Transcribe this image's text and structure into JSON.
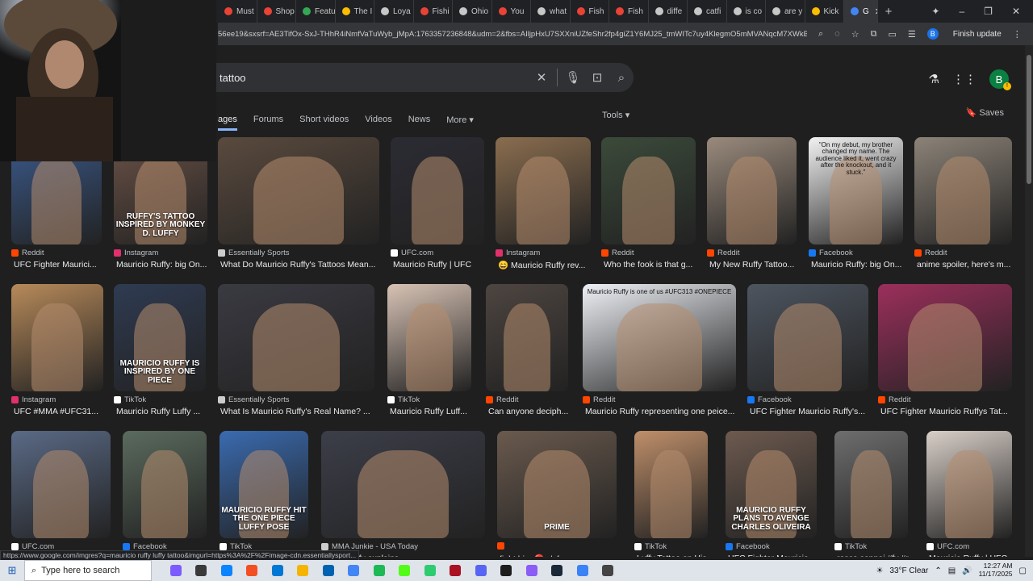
{
  "browser": {
    "tabs": [
      {
        "label": "Must",
        "color": "#ea4335"
      },
      {
        "label": "Shop",
        "color": "#ea4335"
      },
      {
        "label": "Featu",
        "color": "#34a853"
      },
      {
        "label": "The I",
        "color": "#fbbc04"
      },
      {
        "label": "Loya",
        "color": "#c7c7c7"
      },
      {
        "label": "Fishi",
        "color": "#ea4335"
      },
      {
        "label": "Ohio",
        "color": "#c7c7c7"
      },
      {
        "label": "You",
        "color": "#ea4335"
      },
      {
        "label": "what",
        "color": "#c7c7c7"
      },
      {
        "label": "Fish",
        "color": "#ea4335"
      },
      {
        "label": "Fish",
        "color": "#ea4335"
      },
      {
        "label": "diffe",
        "color": "#c7c7c7"
      },
      {
        "label": "catfi",
        "color": "#c7c7c7"
      },
      {
        "label": "is co",
        "color": "#c7c7c7"
      },
      {
        "label": "are y",
        "color": "#c7c7c7"
      },
      {
        "label": "Kick",
        "color": "#fbbc04"
      }
    ],
    "active_tab_label": "G",
    "new_tab": "+",
    "url": "56ee19&sxsrf=AE3TifOx-SxJ-THhR4iNmfVaTuWyb_jMpA:1763357236848&udm=2&fbs=AIljpHxU7SXXniUZfeShr2fp4giZ1Y6MJ25_tmWITc7uy4KlegmO5mMVANqcM7XWkB0a0...",
    "finish_update": "Finish update",
    "profile_initial": "B"
  },
  "search": {
    "query": "tattoo",
    "filters": [
      "ages",
      "Forums",
      "Short videos",
      "Videos",
      "News",
      "More ▾"
    ],
    "tools": "Tools ▾",
    "saves": "Saves",
    "account_initial": "B"
  },
  "results": [
    {
      "source": "Reddit",
      "title": "UFC Fighter Maurici...",
      "sc": "#ff4500",
      "bg": "#3b5a8c"
    },
    {
      "source": "Instagram",
      "title": "Mauricio Ruffy: big On...",
      "sc": "#e1306c",
      "bg": "#6b5247",
      "text": "RUFFY'S TATTOO INSPIRED BY MONKEY D. LUFFY"
    },
    {
      "source": "Essentially Sports",
      "title": "What Do Mauricio Ruffy's Tattoos Mean...",
      "sc": "#cccccc",
      "bg": "#5a4a3e"
    },
    {
      "source": "UFC.com",
      "title": "Mauricio Ruffy | UFC",
      "sc": "#ffffff",
      "bg": "#2b2b33"
    },
    {
      "source": "Instagram",
      "title": "😄 Mauricio Ruffy rev...",
      "sc": "#e1306c",
      "bg": "#8a6d4f"
    },
    {
      "source": "Reddit",
      "title": "Who the fook is that g...",
      "sc": "#ff4500",
      "bg": "#3b4a3a"
    },
    {
      "source": "Reddit",
      "title": "My New Ruffy Tattoo...",
      "sc": "#ff4500",
      "bg": "#9a8a7c"
    },
    {
      "source": "Facebook",
      "title": "Mauricio Ruffy: big On...",
      "sc": "#1877f2",
      "bg": "#f2f2f2",
      "text": "\"On my debut, my brother changed my name. The audience liked it, went crazy after the knockout, and it stuck.\""
    },
    {
      "source": "Reddit",
      "title": "anime spoiler, here's m...",
      "sc": "#ff4500",
      "bg": "#8c8378"
    },
    {
      "source": "Instagram",
      "title": "UFC #MMA #UFC31...",
      "sc": "#e1306c",
      "bg": "#b78a5a"
    },
    {
      "source": "TikTok",
      "title": "Mauricio Ruffy Luffy ...",
      "sc": "#ffffff",
      "bg": "#2f3b52",
      "text": "MAURICIO RUFFY IS INSPIRED BY ONE PIECE"
    },
    {
      "source": "Essentially Sports",
      "title": "What Is Mauricio Ruffy's Real Name? ...",
      "sc": "#cccccc",
      "bg": "#3a3a42"
    },
    {
      "source": "TikTok",
      "title": "Mauricio Ruffy Luff...",
      "sc": "#ffffff",
      "bg": "#d8c3b5"
    },
    {
      "source": "Reddit",
      "title": "Can anyone deciph...",
      "sc": "#ff4500",
      "bg": "#4d4540"
    },
    {
      "source": "Reddit",
      "title": "Mauricio Ruffy representing one peice...",
      "sc": "#ff4500",
      "bg": "#eef1f6",
      "text": "Mauricio Ruffy is one of us #UFC313 #ONEPIECE"
    },
    {
      "source": "Facebook",
      "title": "UFC Fighter Mauricio Ruffy's...",
      "sc": "#1877f2",
      "bg": "#4d5560"
    },
    {
      "source": "Reddit",
      "title": "UFC Fighter Mauricio Ruffys Tat...",
      "sc": "#ff4500",
      "bg": "#9c2f5c"
    },
    {
      "source": "UFC.com",
      "title": "",
      "sc": "#ffffff",
      "bg": "#5a6a86"
    },
    {
      "source": "Facebook",
      "title": "",
      "sc": "#1877f2",
      "bg": "#5b6b5e"
    },
    {
      "source": "TikTok",
      "title": "",
      "sc": "#ffffff",
      "bg": "#3a6bb0",
      "text": "MAURICIO RUFFY HIT THE ONE PIECE LUFFY POSE"
    },
    {
      "source": "MMA Junkie - USA Today",
      "title": "...icio Ruffy explains",
      "sc": "#cccccc",
      "bg": "#3c3e49"
    },
    {
      "source": "",
      "title": "fight him 🔴 r/ufc",
      "sc": "#ff4500",
      "bg": "#6a5a4e",
      "text": "PRIME"
    },
    {
      "source": "TikTok",
      "title": "Luffy Tattoo on His...",
      "sc": "#ffffff",
      "bg": "#bf8f6a"
    },
    {
      "source": "Facebook",
      "title": "UFC Fighter Mauricio...",
      "sc": "#1877f2",
      "bg": "#6d5a4f",
      "text": "MAURICIO RUFFY PLANS TO AVENGE CHARLES OLIVEIRA"
    },
    {
      "source": "TikTok",
      "title": "rosco sennai #fy #r...",
      "sc": "#ffffff",
      "bg": "#6e6e6e"
    },
    {
      "source": "UFC.com",
      "title": "Mauricio Ruffy | UFC",
      "sc": "#ffffff",
      "bg": "#d9cfc8"
    }
  ],
  "status_link": "https://www.google.com/imgres?q=mauricio ruffy luffy tattoo&imgurl=https%3A%2F%2Fimage-cdn.essentiallysport...",
  "taskbar": {
    "search_placeholder": "Type here to search",
    "weather": "33°F  Clear",
    "time": "12:27 AM",
    "date": "11/17/2025",
    "app_colors": [
      "#7b5cff",
      "#3a3a3a",
      "#0a84ff",
      "#f25022",
      "#0078d4",
      "#f4b400",
      "#0063b1",
      "#4285f4",
      "#1db954",
      "#53fc18",
      "#2ecc71",
      "#a12",
      "#5865f2",
      "#1d1d1d",
      "#8b5cf6",
      "#1b2838",
      "#3b82f6",
      "#444"
    ]
  }
}
